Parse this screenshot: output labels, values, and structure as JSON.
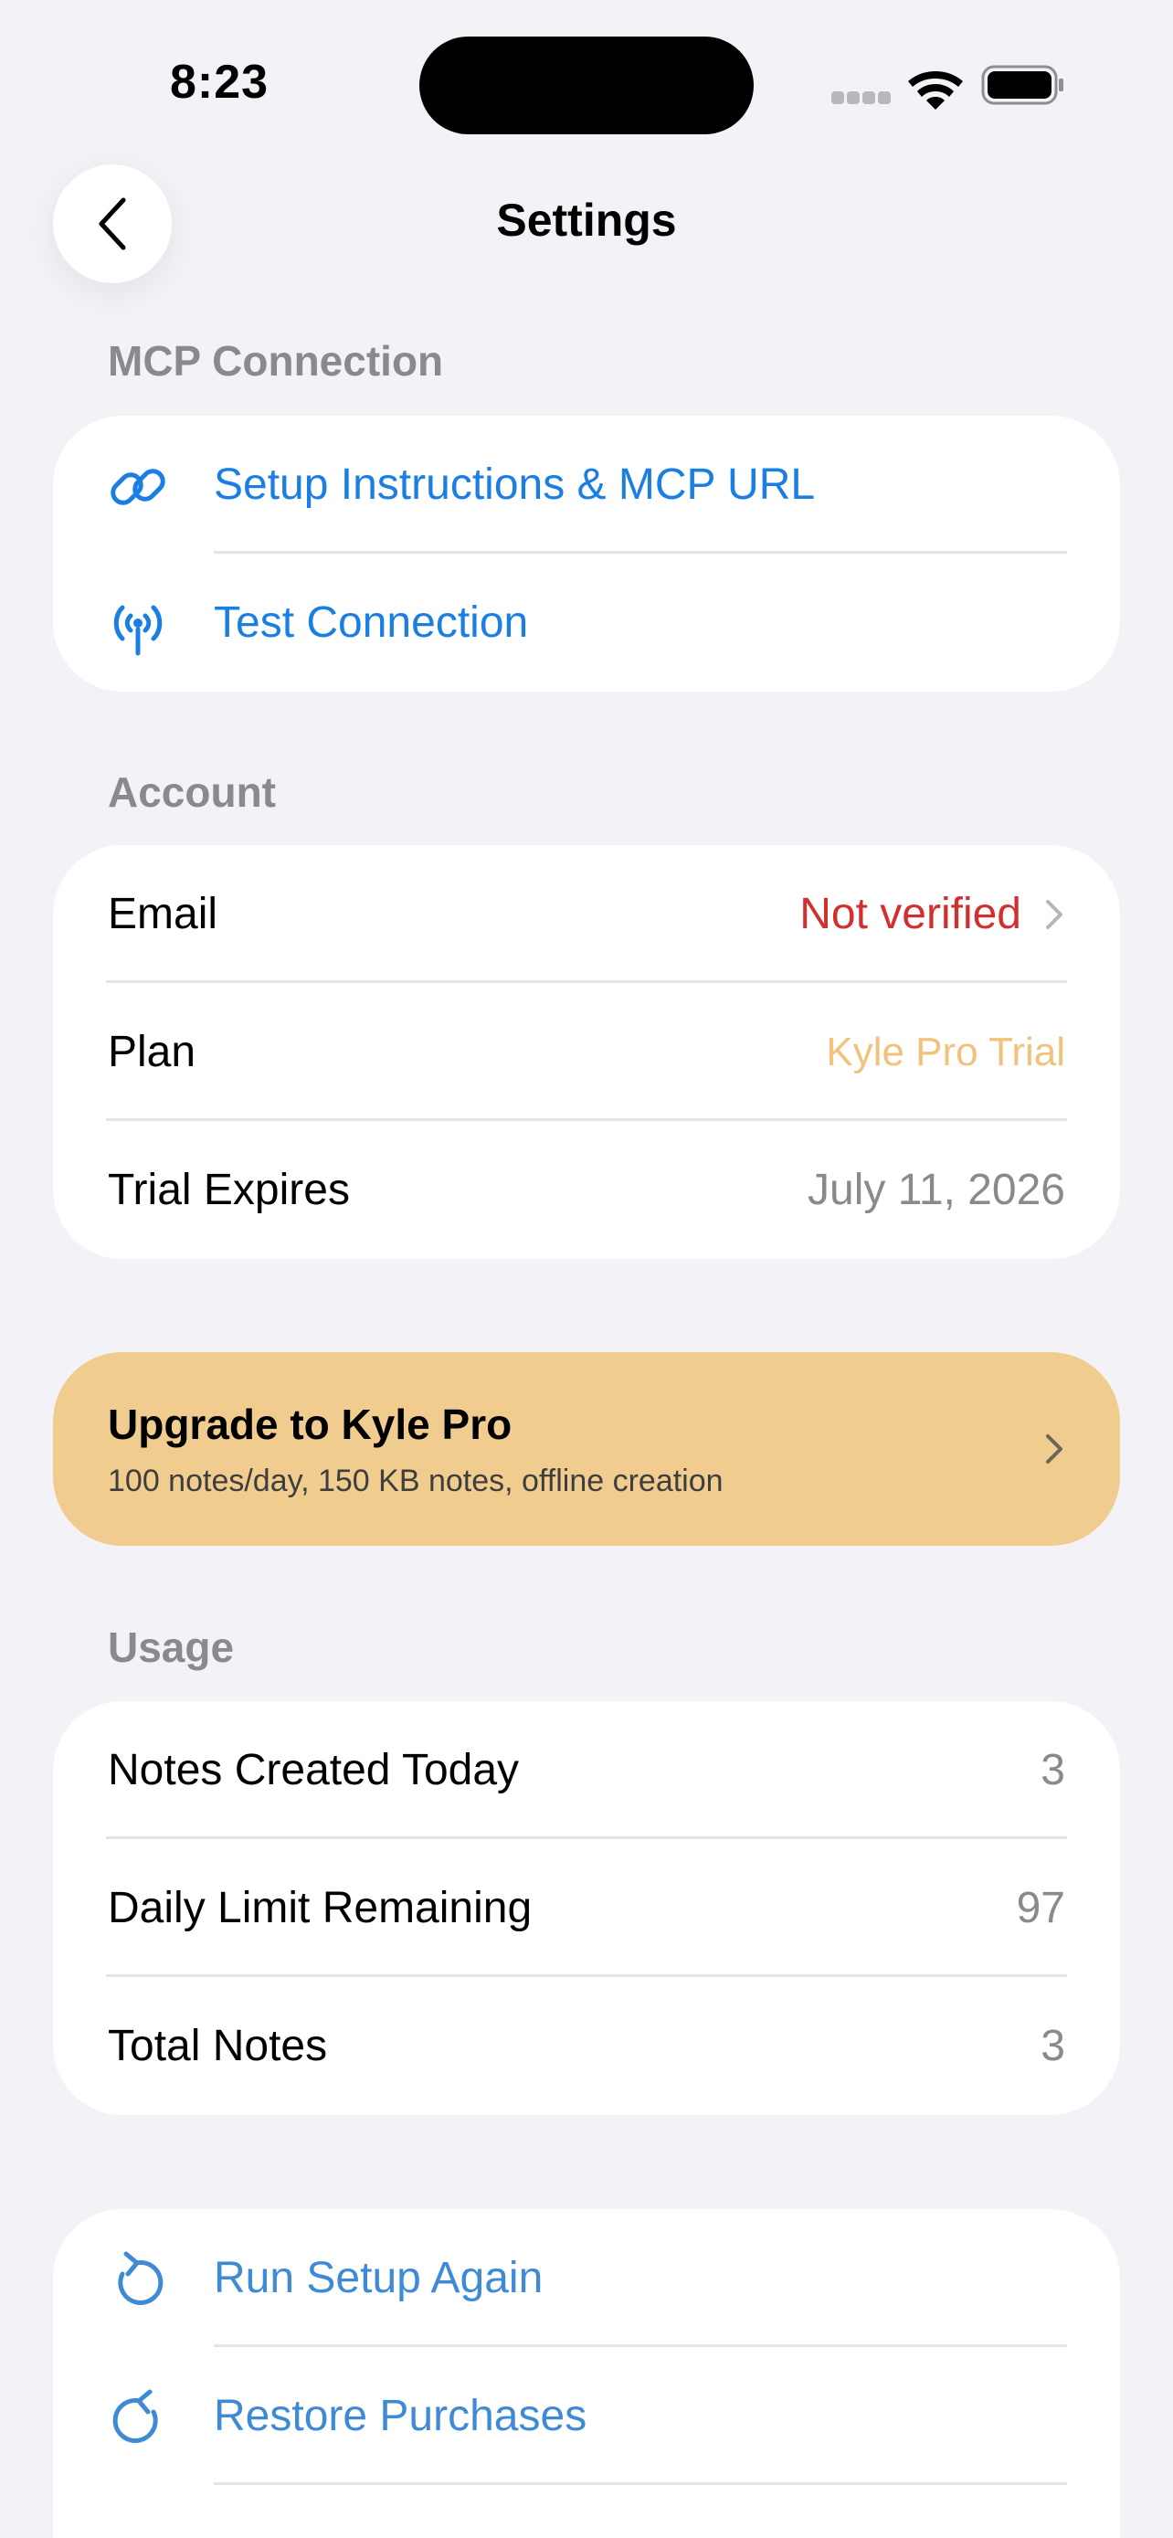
{
  "status_bar": {
    "time": "8:23"
  },
  "nav": {
    "title": "Settings"
  },
  "mcp": {
    "header": "MCP Connection",
    "items": [
      {
        "label": "Setup Instructions & MCP URL",
        "icon": "link-icon"
      },
      {
        "label": "Test Connection",
        "icon": "antenna-icon"
      }
    ]
  },
  "account": {
    "header": "Account",
    "rows": [
      {
        "label": "Email",
        "value": "Not verified"
      },
      {
        "label": "Plan",
        "value": "Kyle Pro Trial"
      },
      {
        "label": "Trial Expires",
        "value": "July 11, 2026"
      }
    ]
  },
  "upgrade": {
    "title": "Upgrade to Kyle Pro",
    "subtitle": "100 notes/day, 150 KB notes, offline creation"
  },
  "usage": {
    "header": "Usage",
    "rows": [
      {
        "label": "Notes Created Today",
        "value": "3"
      },
      {
        "label": "Daily Limit Remaining",
        "value": "97"
      },
      {
        "label": "Total Notes",
        "value": "3"
      }
    ]
  },
  "actions": {
    "items": [
      {
        "label": "Run Setup Again",
        "icon": "rotate-left-icon"
      },
      {
        "label": "Restore Purchases",
        "icon": "rotate-right-icon"
      }
    ]
  },
  "colors": {
    "background": "#f2f2f7",
    "link_blue": "#1a7ee3",
    "action_blue": "#3f8ad6",
    "warning_red": "#d32f2f",
    "plan_gold": "#f1c27b",
    "upgrade_banner": "#f1cc8f"
  }
}
